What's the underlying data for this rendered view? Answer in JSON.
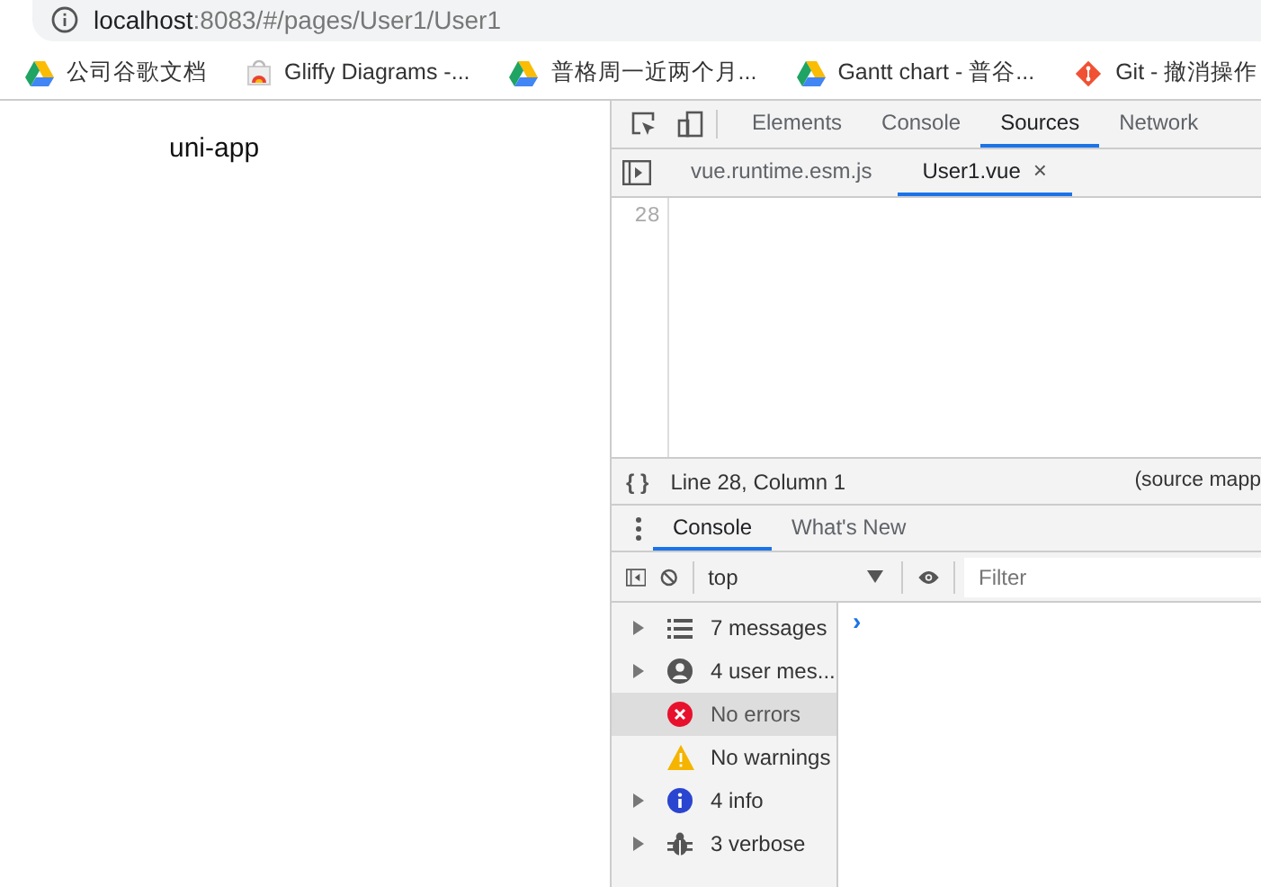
{
  "address_bar": {
    "host": "localhost",
    "path": ":8083/#/pages/User1/User1"
  },
  "bookmarks": [
    {
      "label": "公司谷歌文档",
      "kind": "drive"
    },
    {
      "label": "Gliffy Diagrams -...",
      "kind": "gliffy"
    },
    {
      "label": "普格周一近两个月...",
      "kind": "drive"
    },
    {
      "label": "Gantt chart - 普谷...",
      "kind": "drive"
    },
    {
      "label": "Git - 撤消操作",
      "kind": "git"
    }
  ],
  "page": {
    "title": "uni-app"
  },
  "devtools": {
    "tabs": [
      {
        "label": "Elements",
        "selected": false
      },
      {
        "label": "Console",
        "selected": false
      },
      {
        "label": "Sources",
        "selected": true
      },
      {
        "label": "Network",
        "selected": false
      }
    ],
    "file_tabs": [
      {
        "label": "vue.runtime.esm.js",
        "selected": false
      },
      {
        "label": "User1.vue",
        "selected": true,
        "close": "×"
      }
    ],
    "editor": {
      "line_number": "28"
    },
    "status_bar": {
      "braces": "{ }",
      "position": "Line 28, Column 1",
      "source_map": "(source mapp"
    },
    "drawer_tabs": [
      {
        "label": "Console",
        "selected": true
      },
      {
        "label": "What's New",
        "selected": false
      }
    ],
    "console_toolbar": {
      "context": "top",
      "filter_placeholder": "Filter"
    },
    "sidebar": [
      {
        "label": "7 messages",
        "kind": "messages",
        "expandable": true,
        "selected": false
      },
      {
        "label": "4 user mes...",
        "kind": "user",
        "expandable": true,
        "selected": false
      },
      {
        "label": "No errors",
        "kind": "errors",
        "expandable": false,
        "selected": true
      },
      {
        "label": "No warnings",
        "kind": "warnings",
        "expandable": false,
        "selected": false
      },
      {
        "label": "4 info",
        "kind": "info",
        "expandable": true,
        "selected": false
      },
      {
        "label": "3 verbose",
        "kind": "verbose",
        "expandable": true,
        "selected": false
      }
    ],
    "prompt": "›"
  }
}
